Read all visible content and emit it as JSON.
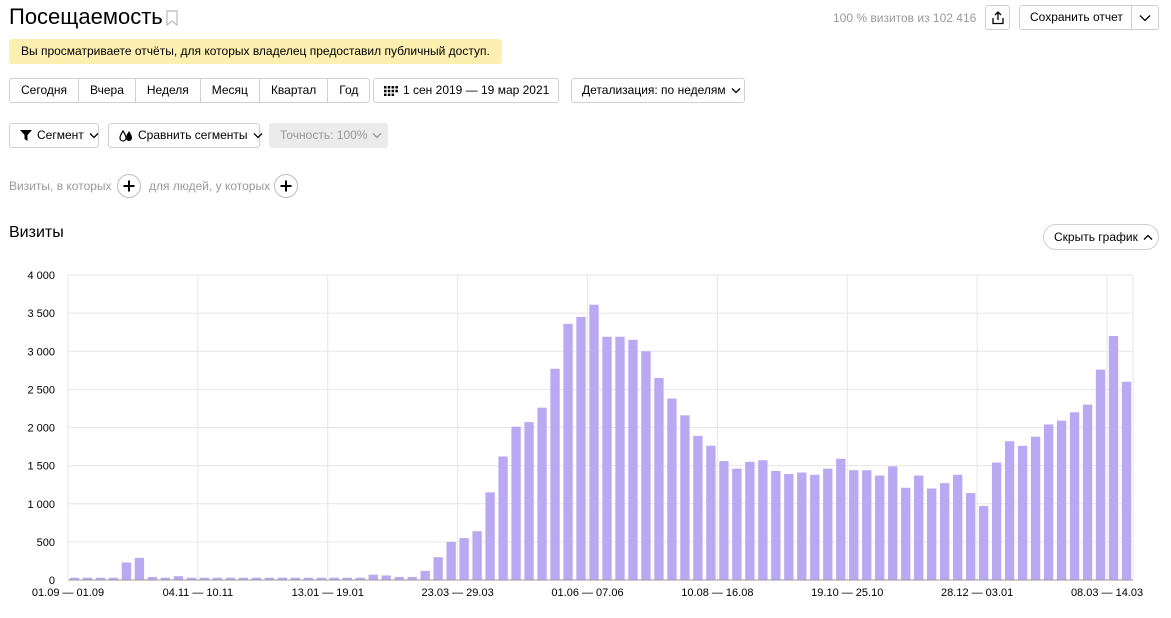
{
  "header": {
    "title": "Посещаемость",
    "visits_share": "100 % визитов из 102 416",
    "save_label": "Сохранить отчет"
  },
  "notice": "Вы просматриваете отчёты, для которых владелец предоставил публичный доступ.",
  "periods": [
    "Сегодня",
    "Вчера",
    "Неделя",
    "Месяц",
    "Квартал",
    "Год"
  ],
  "date_range": "1 сен 2019 — 19 мар 2021",
  "detail_label": "Детализация: по неделям",
  "segment_label": "Сегмент",
  "compare_label": "Сравнить сегменты",
  "accuracy_label": "Точность: 100%",
  "filters": {
    "visits_label": "Визиты, в которых",
    "people_label": "для людей, у которых"
  },
  "section_title": "Визиты",
  "hide_chart_label": "Скрыть график",
  "icons": {
    "bookmark": "bookmark-icon",
    "share": "share-icon",
    "calendar": "calendar-icon",
    "filter": "filter-icon",
    "compare": "compare-segments-icon",
    "plus": "plus-icon",
    "chevron": "chevron-down-icon"
  },
  "colors": {
    "bar": "#b9a9f3",
    "notice_bg": "#fcefb0",
    "grid": "#e6e6e6"
  },
  "chart_data": {
    "type": "bar",
    "ylim": [
      0,
      4000
    ],
    "yticks": [
      0,
      500,
      1000,
      1500,
      2000,
      2500,
      3000,
      3500,
      4000
    ],
    "ytick_labels": [
      "0",
      "500",
      "1 000",
      "1 500",
      "2 000",
      "2 500",
      "3 000",
      "3 500",
      "4 000"
    ],
    "xtick_labels": [
      {
        "index": 0,
        "label": "01.09 — 01.09"
      },
      {
        "index": 10,
        "label": "04.11 — 10.11"
      },
      {
        "index": 20,
        "label": "13.01 — 19.01"
      },
      {
        "index": 30,
        "label": "23.03 — 29.03"
      },
      {
        "index": 40,
        "label": "01.06 — 07.06"
      },
      {
        "index": 50,
        "label": "10.08 — 16.08"
      },
      {
        "index": 60,
        "label": "19.10 — 25.10"
      },
      {
        "index": 70,
        "label": "28.12 — 03.01"
      },
      {
        "index": 80,
        "label": "08.03 — 14.03"
      }
    ],
    "values": [
      30,
      30,
      30,
      30,
      230,
      290,
      40,
      30,
      50,
      30,
      30,
      30,
      30,
      30,
      30,
      30,
      30,
      30,
      30,
      30,
      30,
      30,
      30,
      70,
      60,
      40,
      40,
      120,
      300,
      500,
      550,
      640,
      1150,
      1620,
      2010,
      2070,
      2260,
      2770,
      3360,
      3450,
      3610,
      3190,
      3190,
      3150,
      3000,
      2650,
      2380,
      2160,
      1890,
      1760,
      1560,
      1460,
      1550,
      1570,
      1430,
      1390,
      1410,
      1380,
      1460,
      1590,
      1440,
      1440,
      1370,
      1490,
      1210,
      1370,
      1200,
      1270,
      1380,
      1140,
      970,
      1540,
      1820,
      1760,
      1880,
      2040,
      2090,
      2200,
      2300,
      2760,
      3200,
      2600
    ]
  }
}
